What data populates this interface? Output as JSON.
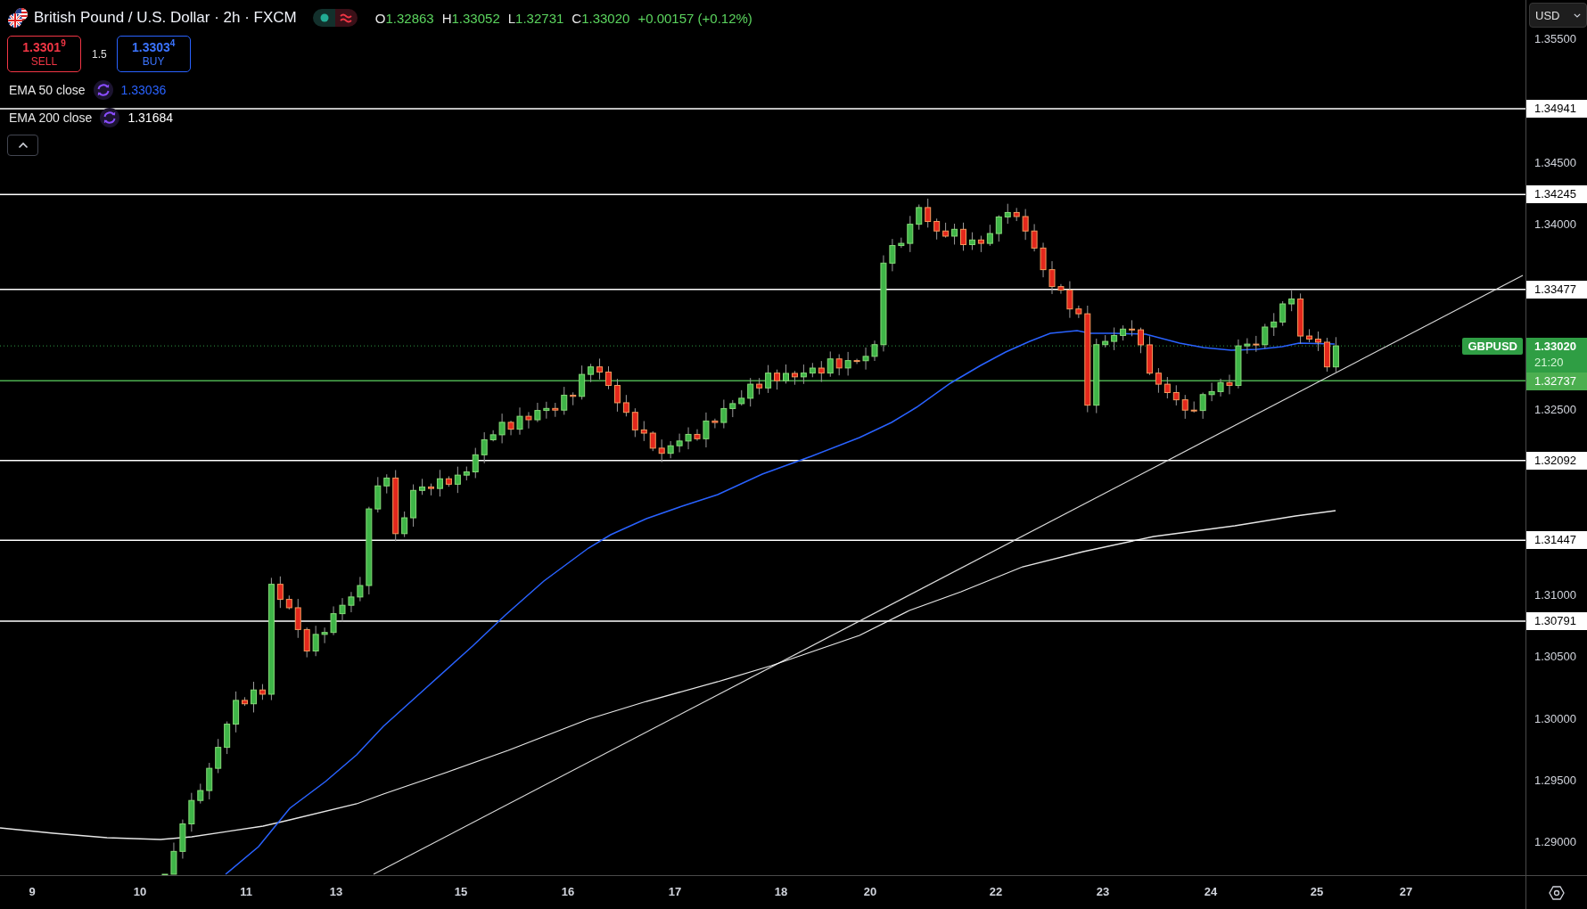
{
  "header": {
    "title": "British Pound / U.S. Dollar · 2h · FXCM",
    "ohlc": [
      {
        "letter": "O",
        "value": "1.32863"
      },
      {
        "letter": "H",
        "value": "1.33052"
      },
      {
        "letter": "L",
        "value": "1.32731"
      },
      {
        "letter": "C",
        "value": "1.33020"
      }
    ],
    "change": "+0.00157 (+0.12%)"
  },
  "quote": {
    "sell": {
      "price": "1.3301$^{9}$",
      "label": "SELL"
    },
    "spread": "1.5",
    "buy": {
      "price": "1.3303$^{4}$",
      "label": "BUY"
    }
  },
  "indicators": [
    {
      "name": "EMA 50 close",
      "value": "1.33036",
      "color": "#2962ff"
    },
    {
      "name": "EMA 200 close",
      "value": "1.31684",
      "color": "#ffffff"
    }
  ],
  "currency": {
    "value": "USD"
  },
  "price_axis": {
    "ticks": [
      "1.35500",
      "1.34500",
      "1.34000",
      "1.32500",
      "1.31000",
      "1.30500",
      "1.30000",
      "1.29500",
      "1.29000"
    ]
  },
  "levels": [
    {
      "price": "1.34941",
      "color": "#ffffff"
    },
    {
      "price": "1.34245",
      "color": "#ffffff"
    },
    {
      "price": "1.33477",
      "color": "#ffffff"
    },
    {
      "price": "1.32737",
      "color": "#4caf50"
    },
    {
      "price": "1.32092",
      "color": "#ffffff"
    },
    {
      "price": "1.31447",
      "color": "#ffffff"
    },
    {
      "price": "1.30791",
      "color": "#ffffff"
    }
  ],
  "last_price": {
    "symbol": "GBPUSD",
    "price": "1.33020",
    "countdown": "21:20"
  },
  "time_axis": {
    "labels": [
      "9",
      "10",
      "11",
      "13",
      "15",
      "16",
      "17",
      "18",
      "20",
      "22",
      "23",
      "24",
      "25",
      "27"
    ]
  }
}
